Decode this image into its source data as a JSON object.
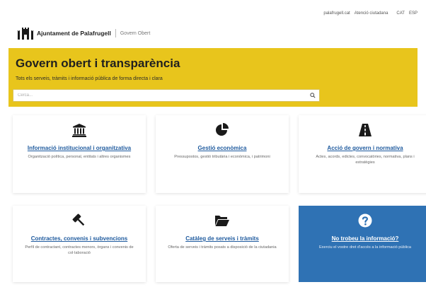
{
  "topbar": {
    "links": [
      "palafrugell.cat",
      "Atenció ciutadana"
    ],
    "languages": [
      "CAT",
      "ESP"
    ]
  },
  "brand": {
    "org_name": "Ajuntament de Palafrugell",
    "section": "Govern Obert"
  },
  "hero": {
    "title": "Govern obert i transparència",
    "subtitle": "Tots els serveis, tràmits i informació pública de forma directa i clara",
    "search_placeholder": "Cerca...",
    "background": "#e8c51c"
  },
  "cards": [
    {
      "icon": "institution-icon",
      "title": "Informació institucional i organitzativa",
      "desc": "Organització política, personal, entitats i altres organismes"
    },
    {
      "icon": "pie-chart-icon",
      "title": "Gestió econòmica",
      "desc": "Pressupostos, gestió tributària i econòmica, i patrimoni"
    },
    {
      "icon": "road-icon",
      "title": "Acció de govern i normativa",
      "desc": "Actes, acords, edictes, convocatòries, normativa, plans i estratègies"
    },
    {
      "icon": "gavel-icon",
      "title": "Contractes, convenis i subvencions",
      "desc": "Perfil de contractant, contractes menors, òrgans i convenis de col·laboració"
    },
    {
      "icon": "folder-open-icon",
      "title": "Catàleg de serveis i tràmits",
      "desc": "Oferta de serveis i tràmits posats a disposició de la ciutadania"
    },
    {
      "icon": "question-circle-icon",
      "title": "No trobeu la informació?",
      "desc": "Exerciu el vostre dret d'accés a la informació pública"
    }
  ],
  "colors": {
    "accent_yellow": "#e8c51c",
    "link_blue": "#1e5a9e",
    "card_blue": "#2f72b4"
  }
}
